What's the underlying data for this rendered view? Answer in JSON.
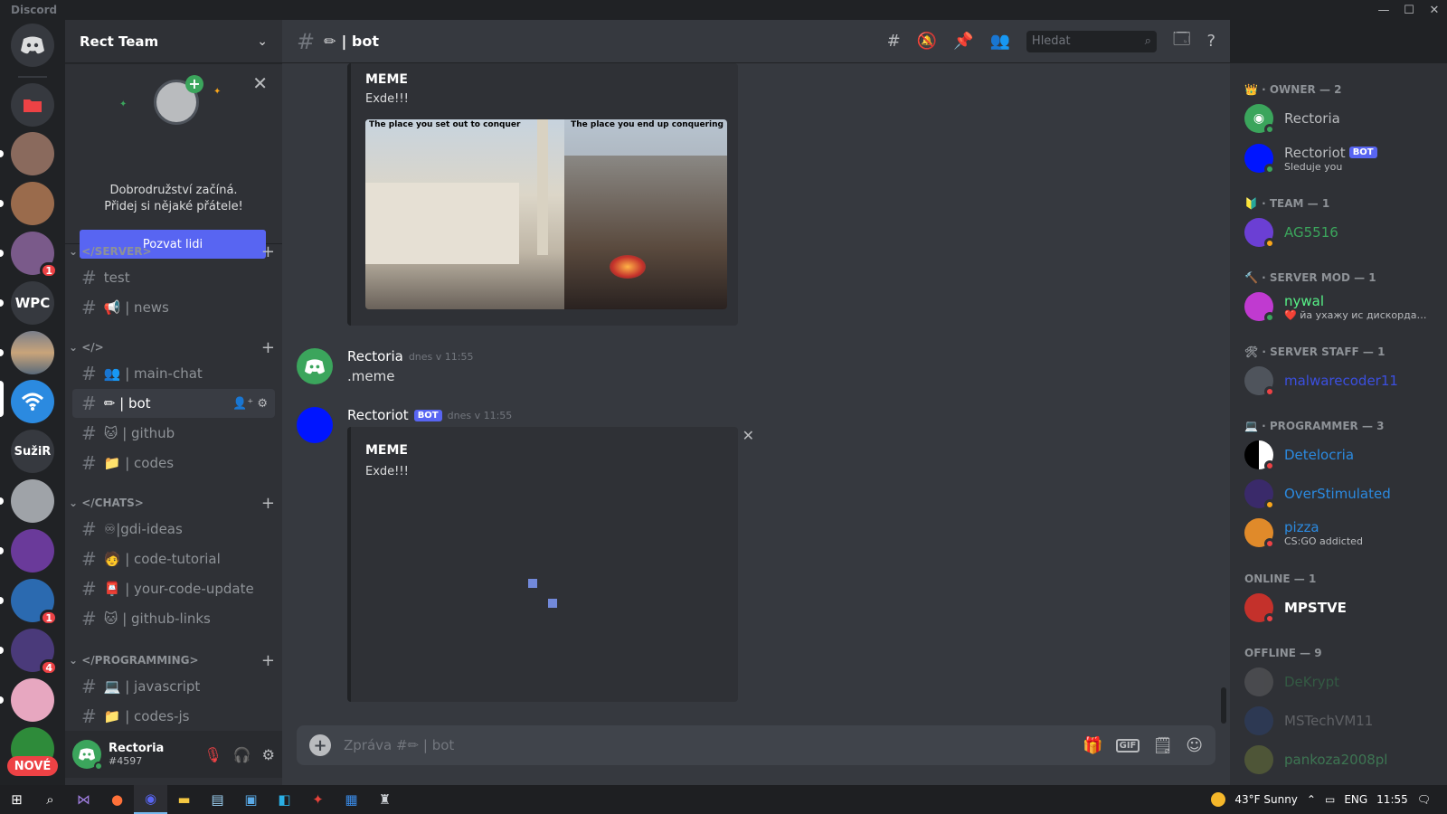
{
  "window": {
    "title": "Discord",
    "min": "—",
    "max": "☐",
    "close": "✕"
  },
  "servers": {
    "items": [
      {
        "label": "",
        "color": "#36393f",
        "badge": ""
      },
      {
        "label": "",
        "color": "#36393f",
        "badge": ""
      },
      {
        "label": "",
        "color": "#8a6a5d",
        "badge": ""
      },
      {
        "label": "",
        "color": "#9a6b4c",
        "badge": ""
      },
      {
        "label": "",
        "color": "#7a5a8a",
        "badge": "1"
      },
      {
        "label": "WPC",
        "color": "#36393f",
        "badge": ""
      },
      {
        "label": "",
        "color": "#7b7f8a",
        "badge": ""
      },
      {
        "label": "",
        "color": "#2b8ae0",
        "badge": ""
      },
      {
        "label": "SužiR",
        "color": "#36393f",
        "badge": ""
      },
      {
        "label": "",
        "color": "#9fa3a8",
        "badge": ""
      },
      {
        "label": "",
        "color": "#6a3a9a",
        "badge": ""
      },
      {
        "label": "",
        "color": "#2b6ab0",
        "badge": "1"
      },
      {
        "label": "",
        "color": "#4a3a7a",
        "badge": "4"
      },
      {
        "label": "",
        "color": "#e7a7c0",
        "badge": ""
      }
    ],
    "new_label": "NOVÉ"
  },
  "guild": {
    "name": "Rect Team"
  },
  "invite": {
    "line1": "Dobrodružství začíná.",
    "line2": "Přidej si nějaké přátele!",
    "button": "Pozvat lidi"
  },
  "categories": [
    {
      "name": "</SERVER>",
      "channels": [
        {
          "emoji": "",
          "name": "test"
        },
        {
          "emoji": "📢",
          "name": "| news"
        }
      ]
    },
    {
      "name": "</>",
      "channels": [
        {
          "emoji": "👥",
          "name": "| main-chat"
        },
        {
          "emoji": "✏",
          "name": "| bot",
          "active": true
        },
        {
          "emoji": "🐱",
          "name": "| github"
        },
        {
          "emoji": "📁",
          "name": "| codes"
        }
      ]
    },
    {
      "name": "</CHATS>",
      "channels": [
        {
          "emoji": "",
          "name": "♾|gdi-ideas"
        },
        {
          "emoji": "🧑",
          "name": "| code-tutorial"
        },
        {
          "emoji": "📮",
          "name": "| your-code-update"
        },
        {
          "emoji": "🐱",
          "name": "| github-links"
        }
      ]
    },
    {
      "name": "</PROGRAMMING>",
      "channels": [
        {
          "emoji": "💻",
          "name": "| javascript"
        },
        {
          "emoji": "📁",
          "name": "| codes-js"
        }
      ]
    }
  ],
  "user": {
    "name": "Rectoria",
    "tag": "#4597"
  },
  "channel_header": {
    "title": "| bot",
    "search_placeholder": "Hledat"
  },
  "messages": {
    "embed1": {
      "title": "MEME",
      "desc": "Exde!!!",
      "img_top_left": "The place you set out to conquer",
      "img_top_right": "The place you end up conquering"
    },
    "msg1": {
      "author": "Rectoria",
      "time": "dnes v 11:55",
      "text": ".meme"
    },
    "msg2": {
      "author": "Rectoriot",
      "badge": "BOT",
      "time": "dnes v 11:55"
    },
    "embed2": {
      "title": "MEME",
      "desc": "Exde!!!"
    }
  },
  "composer": {
    "placeholder": "Zpráva #✏ | bot",
    "gif": "GIF"
  },
  "members": {
    "groups": [
      {
        "title": "👑 · OWNER — 2",
        "members": [
          {
            "name": "Rectoria",
            "color": "#b9bbbe",
            "sub": "",
            "av": "#3ba55c",
            "status": "#3ba55c"
          },
          {
            "name": "Rectoriot",
            "color": "#b9bbbe",
            "sub": "Sleduje you",
            "bot": "BOT",
            "av": "#0015ff",
            "status": "#3ba55c"
          }
        ]
      },
      {
        "title": "🔰 · TEAM — 1",
        "members": [
          {
            "name": "AG5516",
            "color": "#3ba55c",
            "sub": "",
            "av": "#6b3fd4",
            "status": "#faa61a"
          }
        ]
      },
      {
        "title": "🔨 · SERVER MOD — 1",
        "members": [
          {
            "name": "nywal",
            "color": "#57f287",
            "sub": "❤️ йа ухажу ис дискорда ми...",
            "av": "#c03ad0",
            "status": "#3ba55c"
          }
        ]
      },
      {
        "title": "🛠 · SERVER STAFF — 1",
        "members": [
          {
            "name": "malwarecoder11",
            "color": "#3b4fe0",
            "sub": "",
            "av": "#4f545c",
            "status": "#ed4245"
          }
        ]
      },
      {
        "title": "💻 · PROGRAMMER — 3",
        "members": [
          {
            "name": "Detelocria",
            "color": "#2b8ae0",
            "sub": "",
            "av": "#ffffff",
            "status": "#ed4245"
          },
          {
            "name": "OverStimulated",
            "color": "#2b8ae0",
            "sub": "",
            "av": "#3a2a6a",
            "status": "#faa61a"
          },
          {
            "name": "pizza",
            "color": "#2b8ae0",
            "sub": "CS:GO addicted",
            "av": "#e08a2a",
            "status": "#ed4245"
          }
        ]
      },
      {
        "title": "ONLINE — 1",
        "members": [
          {
            "name": "MPSTVE",
            "color": "#ffffff",
            "sub": "",
            "av": "#c4312b",
            "status": "#ed4245"
          }
        ]
      },
      {
        "title": "OFFLINE — 9",
        "members": [
          {
            "name": "DeKrypt",
            "color": "#3ba55c",
            "sub": "",
            "av": "#7a7a7a",
            "off": true
          },
          {
            "name": "MSTechVM11",
            "color": "#b9bbbe",
            "sub": "",
            "av": "#2a4a8a",
            "off": true
          },
          {
            "name": "pankoza2008pl",
            "color": "#57f287",
            "sub": "",
            "av": "#8a9a3a",
            "off": true
          }
        ]
      }
    ]
  },
  "taskbar": {
    "weather": "43°F Sunny",
    "lang": "ENG",
    "clock": "11:55"
  }
}
